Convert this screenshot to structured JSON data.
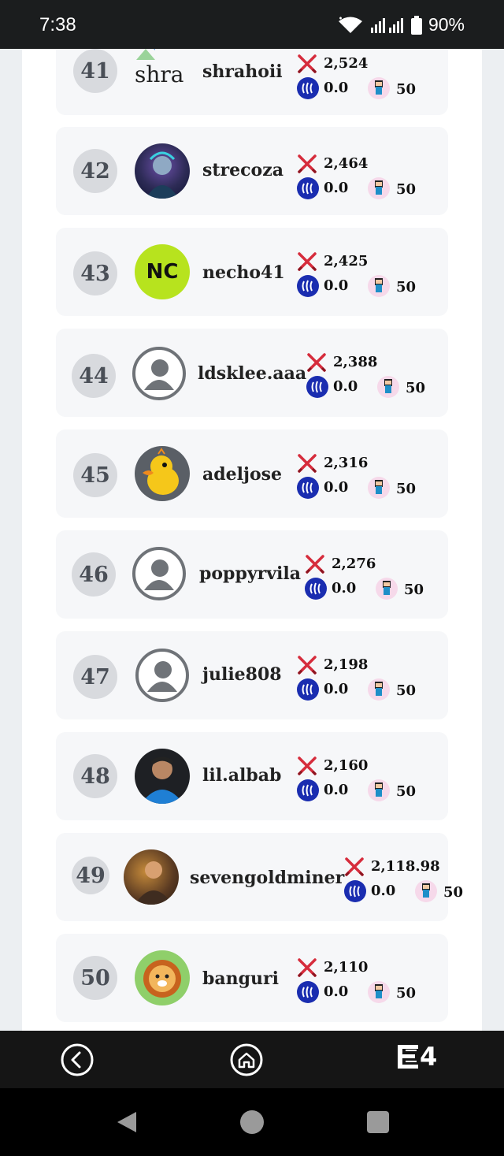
{
  "status_bar": {
    "time": "7:38",
    "battery": "90%"
  },
  "leaderboard": [
    {
      "rank": "41",
      "username": "shrahoii",
      "avatar_text": "shra",
      "avatar": "broken-image",
      "power": "2,524",
      "sp": "0.0",
      "units": "50"
    },
    {
      "rank": "42",
      "username": "strecoza",
      "avatar": "photo",
      "power": "2,464",
      "sp": "0.0",
      "units": "50"
    },
    {
      "rank": "43",
      "username": "necho41",
      "avatar_text": "NC",
      "avatar": "initials",
      "power": "2,425",
      "sp": "0.0",
      "units": "50"
    },
    {
      "rank": "44",
      "username": "ldsklee.aaa",
      "avatar": "default",
      "power": "2,388",
      "sp": "0.0",
      "units": "50"
    },
    {
      "rank": "45",
      "username": "adeljose",
      "avatar": "duck",
      "power": "2,316",
      "sp": "0.0",
      "units": "50"
    },
    {
      "rank": "46",
      "username": "poppyrvila",
      "avatar": "default",
      "power": "2,276",
      "sp": "0.0",
      "units": "50"
    },
    {
      "rank": "47",
      "username": "julie808",
      "avatar": "default",
      "power": "2,198",
      "sp": "0.0",
      "units": "50"
    },
    {
      "rank": "48",
      "username": "lil.albab",
      "avatar": "photo",
      "power": "2,160",
      "sp": "0.0",
      "units": "50"
    },
    {
      "rank": "49",
      "username": "sevengoldminer",
      "avatar": "photo",
      "power": "2,118.98",
      "sp": "0.0",
      "units": "50"
    },
    {
      "rank": "50",
      "username": "banguri",
      "avatar": "lion",
      "power": "2,110",
      "sp": "0.0",
      "units": "50"
    }
  ],
  "bottom_nav": {
    "back": "back-icon",
    "home": "home-icon",
    "logo": "E4"
  },
  "colors": {
    "steem": "#1a2db0",
    "sword": "#d62c3c",
    "row_bg": "#f6f7f9",
    "rank_bg": "#d8dade"
  }
}
